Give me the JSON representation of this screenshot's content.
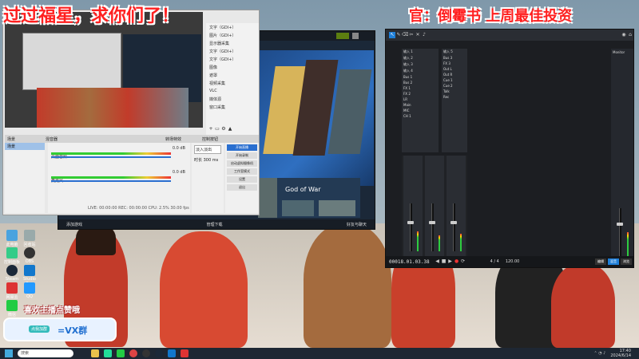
{
  "overlay": {
    "left_banner": "过过福星，求你们了！",
    "right_banner": "官：倒霉书 上周最佳投资",
    "bottom_left_caption": "喜欢主播点赞哦",
    "bubble_text": "=VX群",
    "bubble_chip": "点我加群"
  },
  "obs": {
    "scenes_header": "场景",
    "sources_header": "来源",
    "mixer_header": "混音器",
    "transitions_header": "转场特效",
    "controls_header": "控制按钮",
    "scene_item": "场景",
    "sources": [
      "文字（GDI+）",
      "图片（GDI+）",
      "显示器采集",
      "文字（GDI+）",
      "文字（GDI+）",
      "图像",
      "遮罩",
      "视频采集",
      "VLC",
      "媒体源",
      "窗口采集"
    ],
    "mixer_tracks": [
      {
        "name": "桌面音频",
        "db": "0.0 dB"
      },
      {
        "name": "麦克风",
        "db": "0.0 dB"
      }
    ],
    "transition_value": "淡入淡出",
    "duration_label": "时长",
    "duration_value": "300 ms",
    "controls": [
      "开始直播",
      "开始录制",
      "启动虚拟摄像机",
      "工作室模式",
      "设置",
      "退出"
    ],
    "status": "LIVE: 00:00:00  REC: 00:00:00  CPU: 2.5%  30.00 fps"
  },
  "steam": {
    "featured_title": "God of War",
    "bottom_left": "添加游戏",
    "bottom_mid": "管理下载",
    "bottom_right": "好友与聊天"
  },
  "daw": {
    "time_display": "00018.01.03.38",
    "time_sig": "4 / 4",
    "tempo": "120.00",
    "tracks_left": [
      "输入 1",
      "输入 2",
      "输入 3",
      "输入 4",
      "Bus 1",
      "Bus 2",
      "FX 1",
      "FX 2",
      "LR",
      "Main",
      "MIC",
      "CH 1"
    ],
    "tracks_right": [
      "输入 5",
      "Bus 3",
      "FX 3",
      "Out L",
      "Out R",
      "Cue 1",
      "Cue 2",
      "Talk",
      "Rec"
    ],
    "right_panel_title": "Monitor",
    "bottom_buttons": [
      "编辑",
      "混音",
      "浏览"
    ]
  },
  "desktop_icons": [
    "此电脑",
    "回收站",
    "控制面板",
    "OBS",
    "Steam",
    "Studio One",
    "网易云",
    "QQ",
    "微信"
  ],
  "taskbar": {
    "search_placeholder": "搜索",
    "clock_time": "17:40",
    "clock_date": "2024/6/14"
  },
  "colors": {
    "banner_red": "#ff2020",
    "obs_bg": "#2b2e38",
    "daw_bg": "#1c1e22",
    "daw_accent": "#1f7fd8",
    "steam_blue": "#1b2838"
  }
}
